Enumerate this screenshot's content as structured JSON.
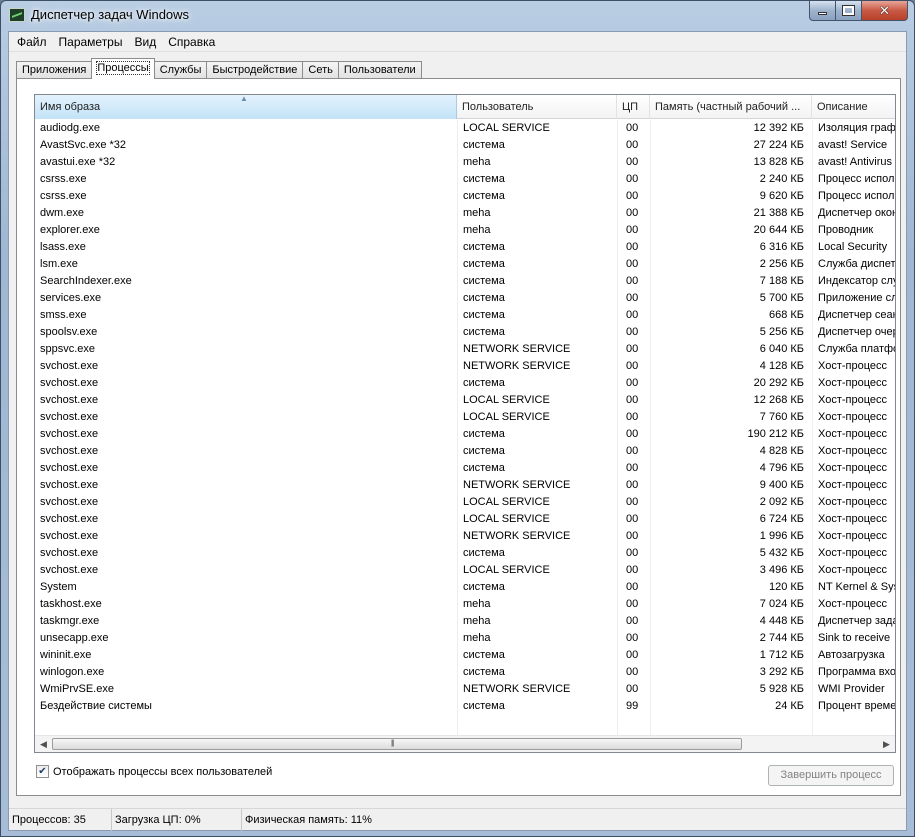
{
  "window": {
    "title": "Диспетчер задач Windows"
  },
  "menu": [
    "Файл",
    "Параметры",
    "Вид",
    "Справка"
  ],
  "tabs": [
    "Приложения",
    "Процессы",
    "Службы",
    "Быстродействие",
    "Сеть",
    "Пользователи"
  ],
  "active_tab": 1,
  "columns": {
    "name": "Имя образа",
    "user": "Пользователь",
    "cpu": "ЦП",
    "memory": "Память (частный рабочий ...",
    "description": "Описание"
  },
  "processes": [
    {
      "name": "audiodg.exe",
      "user": "LOCAL SERVICE",
      "cpu": "00",
      "mem": "12 392 КБ",
      "desc": "Изоляция графов"
    },
    {
      "name": "AvastSvc.exe *32",
      "user": "система",
      "cpu": "00",
      "mem": "27 224 КБ",
      "desc": "avast! Service"
    },
    {
      "name": "avastui.exe *32",
      "user": "meha",
      "cpu": "00",
      "mem": "13 828 КБ",
      "desc": "avast! Antivirus"
    },
    {
      "name": "csrss.exe",
      "user": "система",
      "cpu": "00",
      "mem": "2 240 КБ",
      "desc": "Процесс исполнения"
    },
    {
      "name": "csrss.exe",
      "user": "система",
      "cpu": "00",
      "mem": "9 620 КБ",
      "desc": "Процесс исполнения"
    },
    {
      "name": "dwm.exe",
      "user": "meha",
      "cpu": "00",
      "mem": "21 388 КБ",
      "desc": "Диспетчер окон"
    },
    {
      "name": "explorer.exe",
      "user": "meha",
      "cpu": "00",
      "mem": "20 644 КБ",
      "desc": "Проводник"
    },
    {
      "name": "lsass.exe",
      "user": "система",
      "cpu": "00",
      "mem": "6 316 КБ",
      "desc": "Local Security"
    },
    {
      "name": "lsm.exe",
      "user": "система",
      "cpu": "00",
      "mem": "2 256 КБ",
      "desc": "Служба диспетчера"
    },
    {
      "name": "SearchIndexer.exe",
      "user": "система",
      "cpu": "00",
      "mem": "7 188 КБ",
      "desc": "Индексатор службы"
    },
    {
      "name": "services.exe",
      "user": "система",
      "cpu": "00",
      "mem": "5 700 КБ",
      "desc": "Приложение служб"
    },
    {
      "name": "smss.exe",
      "user": "система",
      "cpu": "00",
      "mem": "668 КБ",
      "desc": "Диспетчер сеанса"
    },
    {
      "name": "spoolsv.exe",
      "user": "система",
      "cpu": "00",
      "mem": "5 256 КБ",
      "desc": "Диспетчер очереди"
    },
    {
      "name": "sppsvc.exe",
      "user": "NETWORK SERVICE",
      "cpu": "00",
      "mem": "6 040 КБ",
      "desc": "Служба платформы"
    },
    {
      "name": "svchost.exe",
      "user": "NETWORK SERVICE",
      "cpu": "00",
      "mem": "4 128 КБ",
      "desc": "Хост-процесс"
    },
    {
      "name": "svchost.exe",
      "user": "система",
      "cpu": "00",
      "mem": "20 292 КБ",
      "desc": "Хост-процесс"
    },
    {
      "name": "svchost.exe",
      "user": "LOCAL SERVICE",
      "cpu": "00",
      "mem": "12 268 КБ",
      "desc": "Хост-процесс"
    },
    {
      "name": "svchost.exe",
      "user": "LOCAL SERVICE",
      "cpu": "00",
      "mem": "7 760 КБ",
      "desc": "Хост-процесс"
    },
    {
      "name": "svchost.exe",
      "user": "система",
      "cpu": "00",
      "mem": "190 212 КБ",
      "desc": "Хост-процесс"
    },
    {
      "name": "svchost.exe",
      "user": "система",
      "cpu": "00",
      "mem": "4 828 КБ",
      "desc": "Хост-процесс"
    },
    {
      "name": "svchost.exe",
      "user": "система",
      "cpu": "00",
      "mem": "4 796 КБ",
      "desc": "Хост-процесс"
    },
    {
      "name": "svchost.exe",
      "user": "NETWORK SERVICE",
      "cpu": "00",
      "mem": "9 400 КБ",
      "desc": "Хост-процесс"
    },
    {
      "name": "svchost.exe",
      "user": "LOCAL SERVICE",
      "cpu": "00",
      "mem": "2 092 КБ",
      "desc": "Хост-процесс"
    },
    {
      "name": "svchost.exe",
      "user": "LOCAL SERVICE",
      "cpu": "00",
      "mem": "6 724 КБ",
      "desc": "Хост-процесс"
    },
    {
      "name": "svchost.exe",
      "user": "NETWORK SERVICE",
      "cpu": "00",
      "mem": "1 996 КБ",
      "desc": "Хост-процесс"
    },
    {
      "name": "svchost.exe",
      "user": "система",
      "cpu": "00",
      "mem": "5 432 КБ",
      "desc": "Хост-процесс"
    },
    {
      "name": "svchost.exe",
      "user": "LOCAL SERVICE",
      "cpu": "00",
      "mem": "3 496 КБ",
      "desc": "Хост-процесс"
    },
    {
      "name": "System",
      "user": "система",
      "cpu": "00",
      "mem": "120 КБ",
      "desc": "NT Kernel & System"
    },
    {
      "name": "taskhost.exe",
      "user": "meha",
      "cpu": "00",
      "mem": "7 024 КБ",
      "desc": "Хост-процесс"
    },
    {
      "name": "taskmgr.exe",
      "user": "meha",
      "cpu": "00",
      "mem": "4 448 КБ",
      "desc": "Диспетчер задач"
    },
    {
      "name": "unsecapp.exe",
      "user": "meha",
      "cpu": "00",
      "mem": "2 744 КБ",
      "desc": "Sink to receive"
    },
    {
      "name": "wininit.exe",
      "user": "система",
      "cpu": "00",
      "mem": "1 712 КБ",
      "desc": "Автозагрузка"
    },
    {
      "name": "winlogon.exe",
      "user": "система",
      "cpu": "00",
      "mem": "3 292 КБ",
      "desc": "Программа входа"
    },
    {
      "name": "WmiPrvSE.exe",
      "user": "NETWORK SERVICE",
      "cpu": "00",
      "mem": "5 928 КБ",
      "desc": "WMI Provider"
    },
    {
      "name": "Бездействие системы",
      "user": "система",
      "cpu": "99",
      "mem": "24 КБ",
      "desc": "Процент времени"
    }
  ],
  "show_all_users": {
    "label": "Отображать процессы всех пользователей",
    "checked": true
  },
  "end_process_label": "Завершить процесс",
  "status": {
    "processes": "Процессов: 35",
    "cpu": "Загрузка ЦП: 0%",
    "memory": "Физическая память: 11%"
  }
}
